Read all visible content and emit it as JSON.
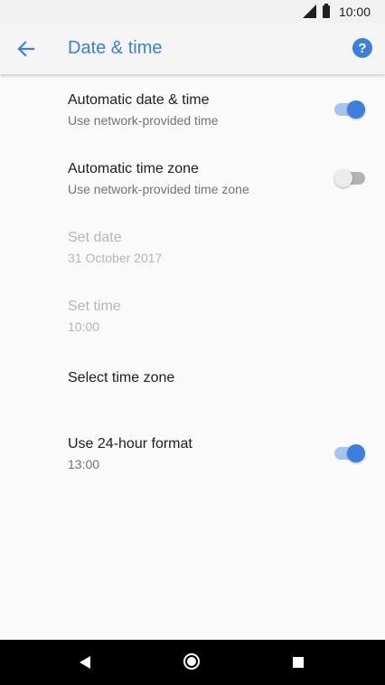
{
  "status_bar": {
    "time": "10:00",
    "icons": [
      "signal-icon",
      "battery-icon"
    ]
  },
  "toolbar": {
    "title": "Date & time",
    "back_icon": "arrow-back-icon",
    "help_icon": "help-icon",
    "help_glyph": "?"
  },
  "colors": {
    "accent": "#3b7fe0",
    "toggle_on_track": "#a7c4f0",
    "toggle_off_track": "#b3b3b3",
    "background": "#fafafa",
    "nav_bar": "#000000"
  },
  "settings": [
    {
      "title": "Automatic date & time",
      "summary": "Use network-provided time",
      "toggle": "on",
      "enabled": true
    },
    {
      "title": "Automatic time zone",
      "summary": "Use network-provided time zone",
      "toggle": "off",
      "enabled": true
    },
    {
      "title": "Set date",
      "summary": "31 October 2017",
      "enabled": false
    },
    {
      "title": "Set time",
      "summary": "10:00",
      "enabled": false
    },
    {
      "title": "Select time zone",
      "enabled": true
    },
    {
      "title": "Use 24-hour format",
      "summary": "13:00",
      "toggle": "on",
      "enabled": true
    }
  ],
  "nav_bar": {
    "icons": [
      "nav-back-icon",
      "nav-home-icon",
      "nav-recents-icon"
    ]
  }
}
